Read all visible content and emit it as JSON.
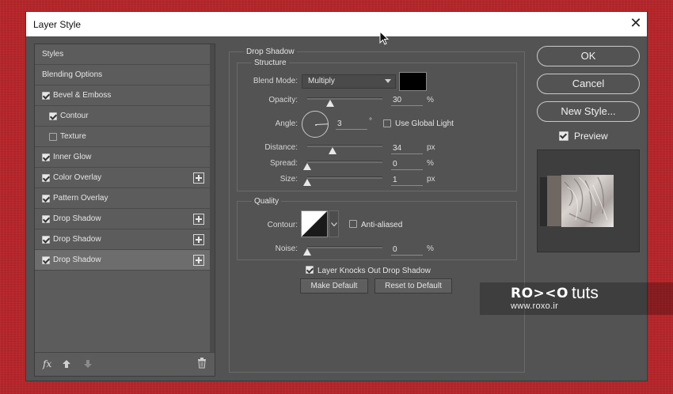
{
  "dialog": {
    "title": "Layer Style"
  },
  "left_panel": {
    "items": [
      {
        "label": "Styles",
        "checkbox": null,
        "plus": false,
        "selected": false
      },
      {
        "label": "Blending Options",
        "checkbox": null,
        "plus": false,
        "selected": false
      },
      {
        "label": "Bevel & Emboss",
        "checkbox": true,
        "plus": false,
        "selected": false
      },
      {
        "label": "Contour",
        "checkbox": true,
        "plus": false,
        "selected": false,
        "indent": true
      },
      {
        "label": "Texture",
        "checkbox": false,
        "plus": false,
        "selected": false,
        "indent": true
      },
      {
        "label": "Inner Glow",
        "checkbox": true,
        "plus": false,
        "selected": false
      },
      {
        "label": "Color Overlay",
        "checkbox": true,
        "plus": true,
        "selected": false
      },
      {
        "label": "Pattern Overlay",
        "checkbox": true,
        "plus": false,
        "selected": false
      },
      {
        "label": "Drop Shadow",
        "checkbox": true,
        "plus": true,
        "selected": false
      },
      {
        "label": "Drop Shadow",
        "checkbox": true,
        "plus": true,
        "selected": false
      },
      {
        "label": "Drop Shadow",
        "checkbox": true,
        "plus": true,
        "selected": true
      }
    ],
    "footer": {
      "fx_label": "fx"
    }
  },
  "drop_shadow": {
    "section_title": "Drop Shadow",
    "structure": {
      "title": "Structure",
      "blend_mode_label": "Blend Mode:",
      "blend_mode_value": "Multiply",
      "shadow_color": "#000000",
      "opacity_label": "Opacity:",
      "opacity_value": "30",
      "opacity_unit": "%",
      "opacity_fraction": 0.3,
      "angle_label": "Angle:",
      "angle_value": "3",
      "angle_unit": "°",
      "angle_degrees": 3,
      "use_global_light_label": "Use Global Light",
      "use_global_light": false,
      "distance_label": "Distance:",
      "distance_value": "34",
      "distance_unit": "px",
      "distance_fraction": 0.34,
      "spread_label": "Spread:",
      "spread_value": "0",
      "spread_unit": "%",
      "spread_fraction": 0,
      "size_label": "Size:",
      "size_value": "1",
      "size_unit": "px",
      "size_fraction": 0.0
    },
    "quality": {
      "title": "Quality",
      "contour_label": "Contour:",
      "anti_aliased_label": "Anti-aliased",
      "anti_aliased": false,
      "noise_label": "Noise:",
      "noise_value": "0",
      "noise_unit": "%",
      "noise_fraction": 0
    },
    "knocks_out_label": "Layer Knocks Out Drop Shadow",
    "knocks_out": true,
    "make_default_label": "Make Default",
    "reset_default_label": "Reset to Default"
  },
  "right_panel": {
    "ok_label": "OK",
    "cancel_label": "Cancel",
    "new_style_label": "New Style...",
    "preview_label": "Preview",
    "preview_checked": true
  },
  "watermark": {
    "logo": "RO><O",
    "tuts": "tuts",
    "url": "www.roxo.ir"
  },
  "colors": {
    "background_red": "#b5262a",
    "panel": "#535353"
  }
}
